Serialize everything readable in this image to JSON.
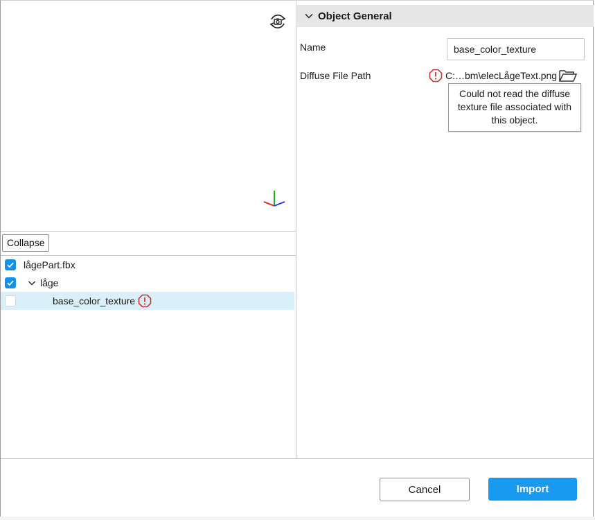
{
  "viewport": {
    "camera_icon": "rotate-camera-icon",
    "axis_icon": "axis-gizmo-icon",
    "axis_colors": {
      "x": "#e02424",
      "y": "#14b814",
      "z": "#2a39e0"
    }
  },
  "tree": {
    "collapse_label": "Collapse",
    "items": [
      {
        "label": "lågePart.fbx",
        "checked": true
      },
      {
        "label": "låge",
        "checked": true,
        "expanded": true
      },
      {
        "label": "base_color_texture",
        "checked": false,
        "selected": true,
        "warning": true
      }
    ]
  },
  "properties": {
    "section_title": "Object General",
    "name_label": "Name",
    "name_value": "base_color_texture",
    "diffuse_label": "Diffuse File Path",
    "diffuse_value": "C:…bm\\elecLågeText.png",
    "tooltip": "Could not read the diffuse texture file associated with this object."
  },
  "footer": {
    "cancel_label": "Cancel",
    "import_label": "Import"
  },
  "colors": {
    "accent": "#1a99f0",
    "warning": "#d32f2f",
    "selection": "#d9f0fb"
  }
}
